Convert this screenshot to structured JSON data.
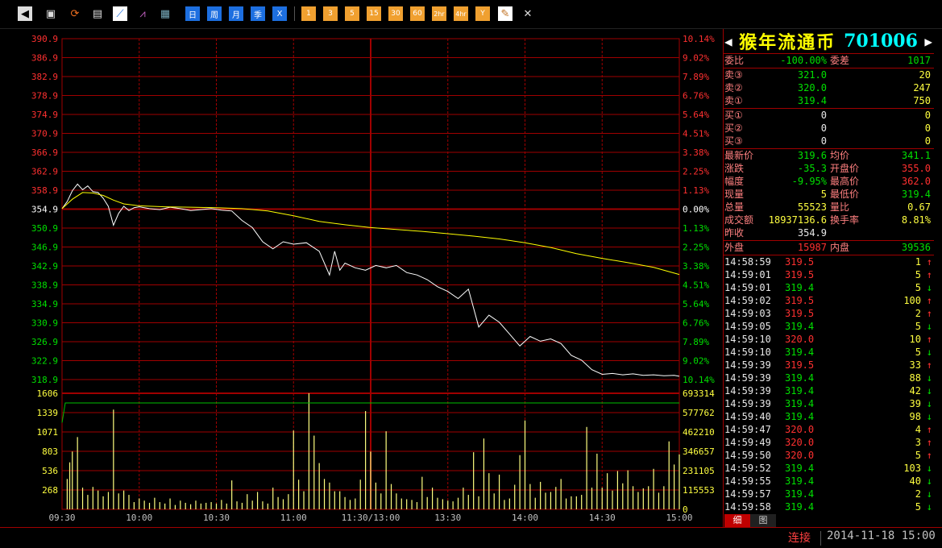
{
  "toolbar": {
    "icons": [
      "back-icon",
      "package-icon",
      "refresh-icon",
      "clipboard-icon",
      "intraday-chart-icon",
      "kline-chart-icon",
      "table-icon"
    ],
    "period_buttons": [
      "日",
      "周",
      "月",
      "季",
      "Ⅹ"
    ],
    "minute_buttons": [
      "1",
      "3",
      "5",
      "15",
      "30",
      "60",
      "2hr",
      "4hr",
      "Y"
    ],
    "tool_icons": [
      "pencil-icon",
      "tools-icon"
    ]
  },
  "chart_data": {
    "type": "line",
    "price_axis": {
      "ylim": [
        318.9,
        390.9
      ],
      "left_ticks": [
        "390.9",
        "386.9",
        "382.9",
        "378.9",
        "374.9",
        "370.9",
        "366.9",
        "362.9",
        "358.9",
        "354.9",
        "350.9",
        "346.9",
        "342.9",
        "338.9",
        "334.9",
        "330.9",
        "326.9",
        "322.9",
        "318.9"
      ],
      "right_ticks": [
        "10.14%",
        "9.02%",
        "7.89%",
        "6.76%",
        "5.64%",
        "4.51%",
        "3.38%",
        "2.25%",
        "1.13%",
        "0.00%",
        "1.13%",
        "2.25%",
        "3.38%",
        "4.51%",
        "5.64%",
        "6.76%",
        "7.89%",
        "9.02%",
        "10.14%"
      ],
      "prev_close": 354.9
    },
    "volume_axis": {
      "ylim": [
        0,
        1606
      ],
      "left_ticks": [
        "1606",
        "1339",
        "1071",
        "803",
        "536",
        "268"
      ],
      "right_ticks": [
        "693314",
        "577762",
        "462210",
        "346657",
        "231105",
        "115553",
        "0"
      ]
    },
    "x_ticks": [
      "09:30",
      "10:00",
      "10:30",
      "11:00",
      "11:30/13:00",
      "13:30",
      "14:00",
      "14:30",
      "15:00"
    ],
    "series": [
      {
        "x": [
          0,
          2,
          4,
          6,
          8,
          10,
          12,
          14,
          16,
          18,
          20,
          22,
          24,
          26,
          28,
          30,
          34,
          38,
          42,
          46,
          50,
          54,
          58,
          62,
          66,
          70,
          74,
          78,
          82,
          86,
          90,
          95,
          100,
          104,
          106,
          108,
          110,
          114,
          118,
          122,
          126,
          130,
          134,
          138,
          142,
          146,
          150,
          154,
          158,
          162,
          166,
          170,
          174,
          178,
          182,
          186,
          190,
          194,
          198,
          202,
          206,
          210,
          214,
          218,
          222,
          226,
          230,
          234,
          238,
          240
        ],
        "values": [
          355.0,
          356.5,
          358.8,
          360.2,
          359.0,
          359.8,
          358.6,
          358.4,
          357.2,
          355.5,
          351.5,
          354.0,
          355.5,
          354.6,
          355.2,
          355.4,
          355.0,
          354.8,
          355.3,
          355.0,
          354.6,
          354.8,
          355.0,
          354.7,
          354.5,
          352.5,
          351.0,
          348.0,
          346.5,
          348.0,
          347.5,
          347.8,
          346.0,
          341.0,
          346.0,
          342.0,
          343.5,
          342.5,
          342.0,
          343.0,
          342.5,
          343.0,
          341.5,
          341.0,
          340.0,
          338.5,
          337.5,
          336.0,
          338.0,
          330.0,
          332.5,
          331.0,
          328.5,
          326.0,
          328.0,
          327.0,
          327.5,
          326.5,
          324.0,
          323.0,
          321.0,
          320.0,
          320.2,
          319.9,
          320.1,
          319.8,
          319.9,
          319.7,
          319.8,
          319.6
        ],
        "color": "#ffffff"
      },
      {
        "x": [
          0,
          4,
          8,
          12,
          16,
          20,
          24,
          30,
          40,
          50,
          60,
          70,
          80,
          90,
          100,
          110,
          120,
          130,
          140,
          150,
          160,
          170,
          180,
          190,
          200,
          210,
          220,
          230,
          240
        ],
        "values": [
          355.0,
          357.0,
          358.4,
          358.3,
          357.8,
          356.8,
          356.0,
          355.6,
          355.4,
          355.3,
          355.2,
          355.0,
          354.5,
          353.5,
          352.3,
          351.6,
          351.0,
          350.6,
          350.2,
          349.7,
          349.2,
          348.6,
          347.8,
          346.8,
          345.5,
          344.5,
          343.6,
          342.6,
          341.1
        ],
        "color": "#ffff00"
      }
    ],
    "volume": {
      "x": [
        2,
        3,
        4,
        6,
        8,
        10,
        12,
        14,
        16,
        18,
        20,
        22,
        24,
        26,
        28,
        30,
        32,
        34,
        36,
        38,
        40,
        42,
        44,
        46,
        48,
        50,
        52,
        54,
        56,
        58,
        60,
        62,
        64,
        66,
        68,
        70,
        72,
        74,
        76,
        78,
        80,
        82,
        84,
        86,
        88,
        90,
        92,
        94,
        96,
        98,
        100,
        102,
        104,
        106,
        108,
        110,
        112,
        114,
        116,
        118,
        120,
        122,
        124,
        126,
        128,
        130,
        132,
        134,
        136,
        138,
        140,
        142,
        144,
        146,
        148,
        150,
        152,
        154,
        156,
        158,
        160,
        162,
        164,
        166,
        168,
        170,
        172,
        174,
        176,
        178,
        180,
        182,
        184,
        186,
        188,
        190,
        192,
        194,
        196,
        198,
        200,
        202,
        204,
        206,
        208,
        210,
        212,
        214,
        216,
        218,
        220,
        222,
        224,
        226,
        228,
        230,
        232,
        234,
        236,
        238,
        240
      ],
      "values": [
        420,
        650,
        800,
        1000,
        300,
        200,
        310,
        260,
        180,
        240,
        1380,
        220,
        260,
        200,
        100,
        150,
        120,
        90,
        160,
        100,
        80,
        150,
        60,
        120,
        90,
        70,
        120,
        80,
        90,
        100,
        80,
        130,
        80,
        400,
        110,
        90,
        210,
        120,
        240,
        110,
        80,
        300,
        170,
        140,
        210,
        1090,
        410,
        250,
        1620,
        1020,
        640,
        420,
        370,
        250,
        250,
        170,
        130,
        150,
        410,
        1360,
        800,
        370,
        220,
        1080,
        350,
        220,
        150,
        140,
        130,
        100,
        450,
        170,
        300,
        160,
        140,
        120,
        110,
        160,
        300,
        200,
        790,
        180,
        980,
        500,
        220,
        480,
        130,
        150,
        340,
        750,
        1230,
        350,
        160,
        380,
        230,
        240,
        310,
        420,
        150,
        180,
        180,
        200,
        1140,
        300,
        770,
        300,
        500,
        260,
        530,
        360,
        540,
        320,
        240,
        290,
        320,
        560,
        230,
        320,
        940,
        620,
        760
      ],
      "color": "#ffff80"
    }
  },
  "quote": {
    "name": "猴年流通币",
    "code": "701006",
    "wei_bi_label": "委比",
    "wei_bi": "-100.00%",
    "wei_cha_label": "委差",
    "wei_cha": "1017",
    "asks": [
      {
        "label": "卖③",
        "price": "321.0",
        "vol": "20"
      },
      {
        "label": "卖②",
        "price": "320.0",
        "vol": "247"
      },
      {
        "label": "卖①",
        "price": "319.4",
        "vol": "750"
      }
    ],
    "bids": [
      {
        "label": "买①",
        "price": "0",
        "vol": "0"
      },
      {
        "label": "买②",
        "price": "0",
        "vol": "0"
      },
      {
        "label": "买③",
        "price": "0",
        "vol": "0"
      }
    ],
    "stats": [
      {
        "l1": "最新价",
        "v1": "319.6",
        "c1": "dn",
        "l2": "均价",
        "v2": "341.1",
        "c2": "dn"
      },
      {
        "l1": "涨跌",
        "v1": "-35.3",
        "c1": "dn",
        "l2": "开盘价",
        "v2": "355.0",
        "c2": "up"
      },
      {
        "l1": "幅度",
        "v1": "-9.95%",
        "c1": "dn",
        "l2": "最高价",
        "v2": "362.0",
        "c2": "up"
      },
      {
        "l1": "现量",
        "v1": "5",
        "c1": "yl",
        "l2": "最低价",
        "v2": "319.4",
        "c2": "dn"
      },
      {
        "l1": "总量",
        "v1": "55523",
        "c1": "yl",
        "l2": "量比",
        "v2": "0.67",
        "c2": "yl"
      },
      {
        "l1": "成交额",
        "v1": "18937136.6",
        "c1": "yl",
        "l2": "换手率",
        "v2": "8.81%",
        "c2": "yl"
      },
      {
        "l1": "昨收",
        "v1": "354.9",
        "c1": "wh",
        "l2": "",
        "v2": "",
        "c2": "wh"
      }
    ],
    "wai_pan_label": "外盘",
    "wai_pan": "15987",
    "nei_pan_label": "内盘",
    "nei_pan": "39536",
    "ticks": [
      {
        "t": "14:58:59",
        "p": "319.5",
        "v": "1",
        "d": "↑"
      },
      {
        "t": "14:59:01",
        "p": "319.5",
        "v": "5",
        "d": "↑"
      },
      {
        "t": "14:59:01",
        "p": "319.4",
        "v": "5",
        "d": "↓"
      },
      {
        "t": "14:59:02",
        "p": "319.5",
        "v": "100",
        "d": "↑"
      },
      {
        "t": "14:59:03",
        "p": "319.5",
        "v": "2",
        "d": "↑"
      },
      {
        "t": "14:59:05",
        "p": "319.4",
        "v": "5",
        "d": "↓"
      },
      {
        "t": "14:59:10",
        "p": "320.0",
        "v": "10",
        "d": "↑"
      },
      {
        "t": "14:59:10",
        "p": "319.4",
        "v": "5",
        "d": "↓"
      },
      {
        "t": "14:59:39",
        "p": "319.5",
        "v": "33",
        "d": "↑"
      },
      {
        "t": "14:59:39",
        "p": "319.4",
        "v": "88",
        "d": "↓"
      },
      {
        "t": "14:59:39",
        "p": "319.4",
        "v": "42",
        "d": "↓"
      },
      {
        "t": "14:59:39",
        "p": "319.4",
        "v": "39",
        "d": "↓"
      },
      {
        "t": "14:59:40",
        "p": "319.4",
        "v": "98",
        "d": "↓"
      },
      {
        "t": "14:59:47",
        "p": "320.0",
        "v": "4",
        "d": "↑"
      },
      {
        "t": "14:59:49",
        "p": "320.0",
        "v": "3",
        "d": "↑"
      },
      {
        "t": "14:59:50",
        "p": "320.0",
        "v": "5",
        "d": "↑"
      },
      {
        "t": "14:59:52",
        "p": "319.4",
        "v": "103",
        "d": "↓"
      },
      {
        "t": "14:59:55",
        "p": "319.4",
        "v": "40",
        "d": "↓"
      },
      {
        "t": "14:59:57",
        "p": "319.4",
        "v": "2",
        "d": "↓"
      },
      {
        "t": "14:59:58",
        "p": "319.4",
        "v": "5",
        "d": "↓"
      }
    ],
    "tabs": [
      "细",
      "图"
    ]
  },
  "status": {
    "connection": "连接",
    "datetime": "2014-11-18 15:00"
  },
  "colors": {
    "grid": "#a00000",
    "up": "#ff3030",
    "down": "#00e000",
    "price_line": "#ffffff",
    "avg_line": "#ffff00",
    "volume": "#ffff80"
  }
}
